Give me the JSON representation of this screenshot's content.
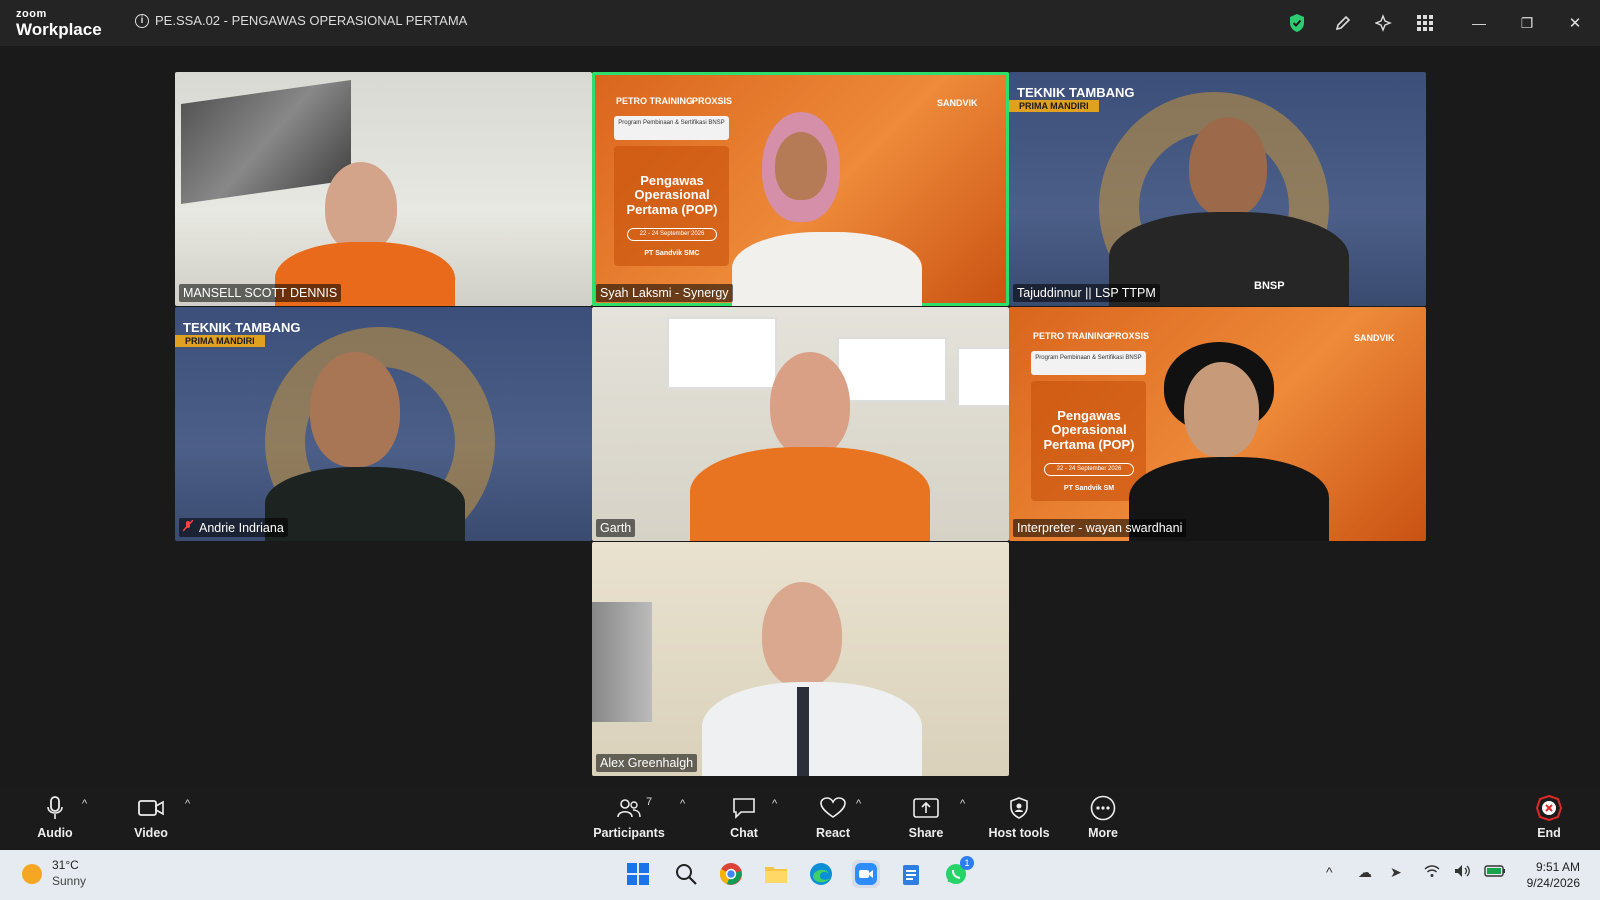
{
  "app": {
    "logo_line1": "zoom",
    "logo_line2": "Workplace",
    "meeting_title": "PE.SSA.02 - PENGAWAS OPERASIONAL PERTAMA",
    "info_icon": "i"
  },
  "titlebar_icons": {
    "shield": "shield-check-icon",
    "pen": "pen-icon",
    "sparkle": "ai-sparkle-icon",
    "apps": "apps-grid-icon",
    "minimize": "—",
    "restore": "❐",
    "close": "✕"
  },
  "participants": [
    {
      "name": "MANSELL SCOTT DENNIS",
      "muted": false,
      "active": false
    },
    {
      "name": "Syah Laksmi - Synergy",
      "muted": false,
      "active": true
    },
    {
      "name": "Tajuddinnur || LSP TTPM",
      "muted": false,
      "active": false
    },
    {
      "name": "Andrie Indriana",
      "muted": true,
      "active": false
    },
    {
      "name": "Garth",
      "muted": false,
      "active": false
    },
    {
      "name": "Interpreter - wayan swardhani",
      "muted": false,
      "active": false
    },
    {
      "name": "Alex Greenhalgh",
      "muted": false,
      "active": false
    }
  ],
  "background_text": {
    "pop_title": "Pengawas Operasional Pertama (POP)",
    "program": "Program Pembinaan & Sertifikasi BNSP",
    "date": "22 - 24 September 2026",
    "company_a": "PT Sandvik SMC",
    "company_b": "PT Sandvik SM",
    "sandvik": "SANDVIK",
    "proxsis": "PROXSIS",
    "petro": "PETRO TRAINING",
    "teknik": "TEKNIK TAMBANG",
    "prima": "PRIMA MANDIRI",
    "bnsp": "BNSP"
  },
  "controls": {
    "audio": "Audio",
    "video": "Video",
    "participants": "Participants",
    "participants_count": "7",
    "chat": "Chat",
    "react": "React",
    "share": "Share",
    "host_tools": "Host tools",
    "more": "More",
    "end": "End"
  },
  "taskbar": {
    "temp": "31°C",
    "weather": "Sunny",
    "time": "9:51 AM",
    "date": "9/24/2026",
    "whatsapp_badge": "1"
  },
  "colors": {
    "active_border": "#2ee06b",
    "end_red": "#e02828",
    "shield_green": "#2ecc71"
  }
}
